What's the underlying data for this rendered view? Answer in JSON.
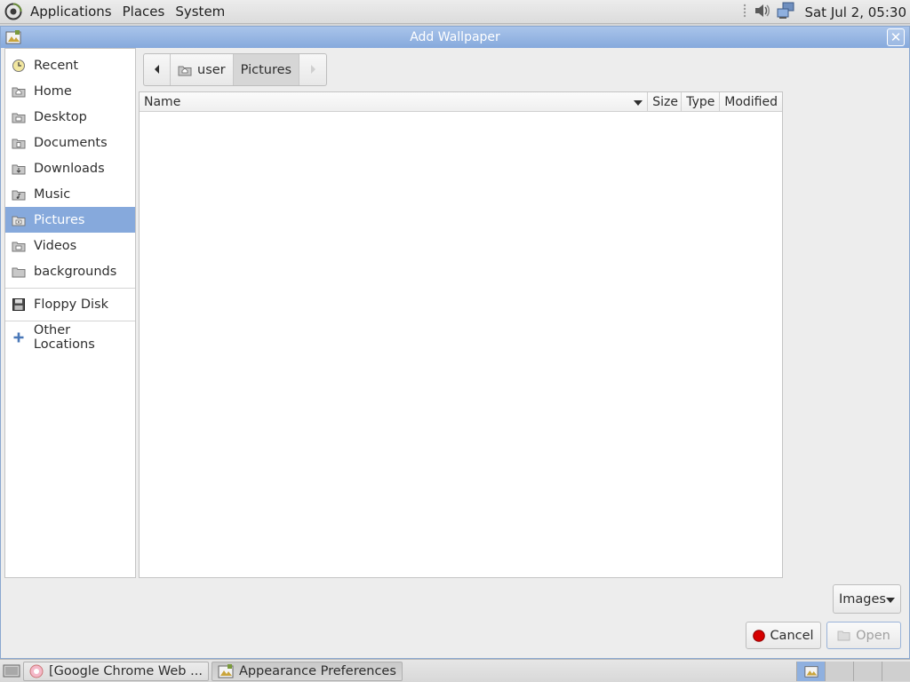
{
  "top_panel": {
    "menus": [
      "Applications",
      "Places",
      "System"
    ],
    "clock": "Sat Jul 2, 05:30",
    "icons": [
      "gnome-foot-icon",
      "volume-icon",
      "network-icon"
    ]
  },
  "dialog": {
    "title": "Add Wallpaper",
    "sidebar": {
      "items": [
        {
          "label": "Recent",
          "icon": "clock-icon"
        },
        {
          "label": "Home",
          "icon": "home-folder-icon"
        },
        {
          "label": "Desktop",
          "icon": "folder-icon"
        },
        {
          "label": "Documents",
          "icon": "folder-icon"
        },
        {
          "label": "Downloads",
          "icon": "folder-icon"
        },
        {
          "label": "Music",
          "icon": "folder-icon"
        },
        {
          "label": "Pictures",
          "icon": "folder-icon",
          "selected": true
        },
        {
          "label": "Videos",
          "icon": "folder-icon"
        },
        {
          "label": "backgrounds",
          "icon": "folder-icon"
        }
      ],
      "devices": [
        {
          "label": "Floppy Disk",
          "icon": "floppy-icon"
        }
      ],
      "other": [
        {
          "label": "Other Locations",
          "icon": "plus-icon"
        }
      ]
    },
    "pathbar": {
      "segments": [
        "user",
        "Pictures"
      ],
      "active": "Pictures"
    },
    "file_list": {
      "columns": [
        "Name",
        "Size",
        "Type",
        "Modified"
      ],
      "rows": []
    },
    "filter": {
      "selected": "Images"
    },
    "buttons": {
      "cancel": "Cancel",
      "open": "Open"
    }
  },
  "taskbar": {
    "tasks": [
      {
        "label": "[Google Chrome Web ...",
        "active": false
      },
      {
        "label": "Appearance Preferences",
        "active": true
      }
    ]
  },
  "colors": {
    "accent": "#86a9dc",
    "titlebar": "#a9c4ea",
    "cancel_red": "#d60000"
  }
}
